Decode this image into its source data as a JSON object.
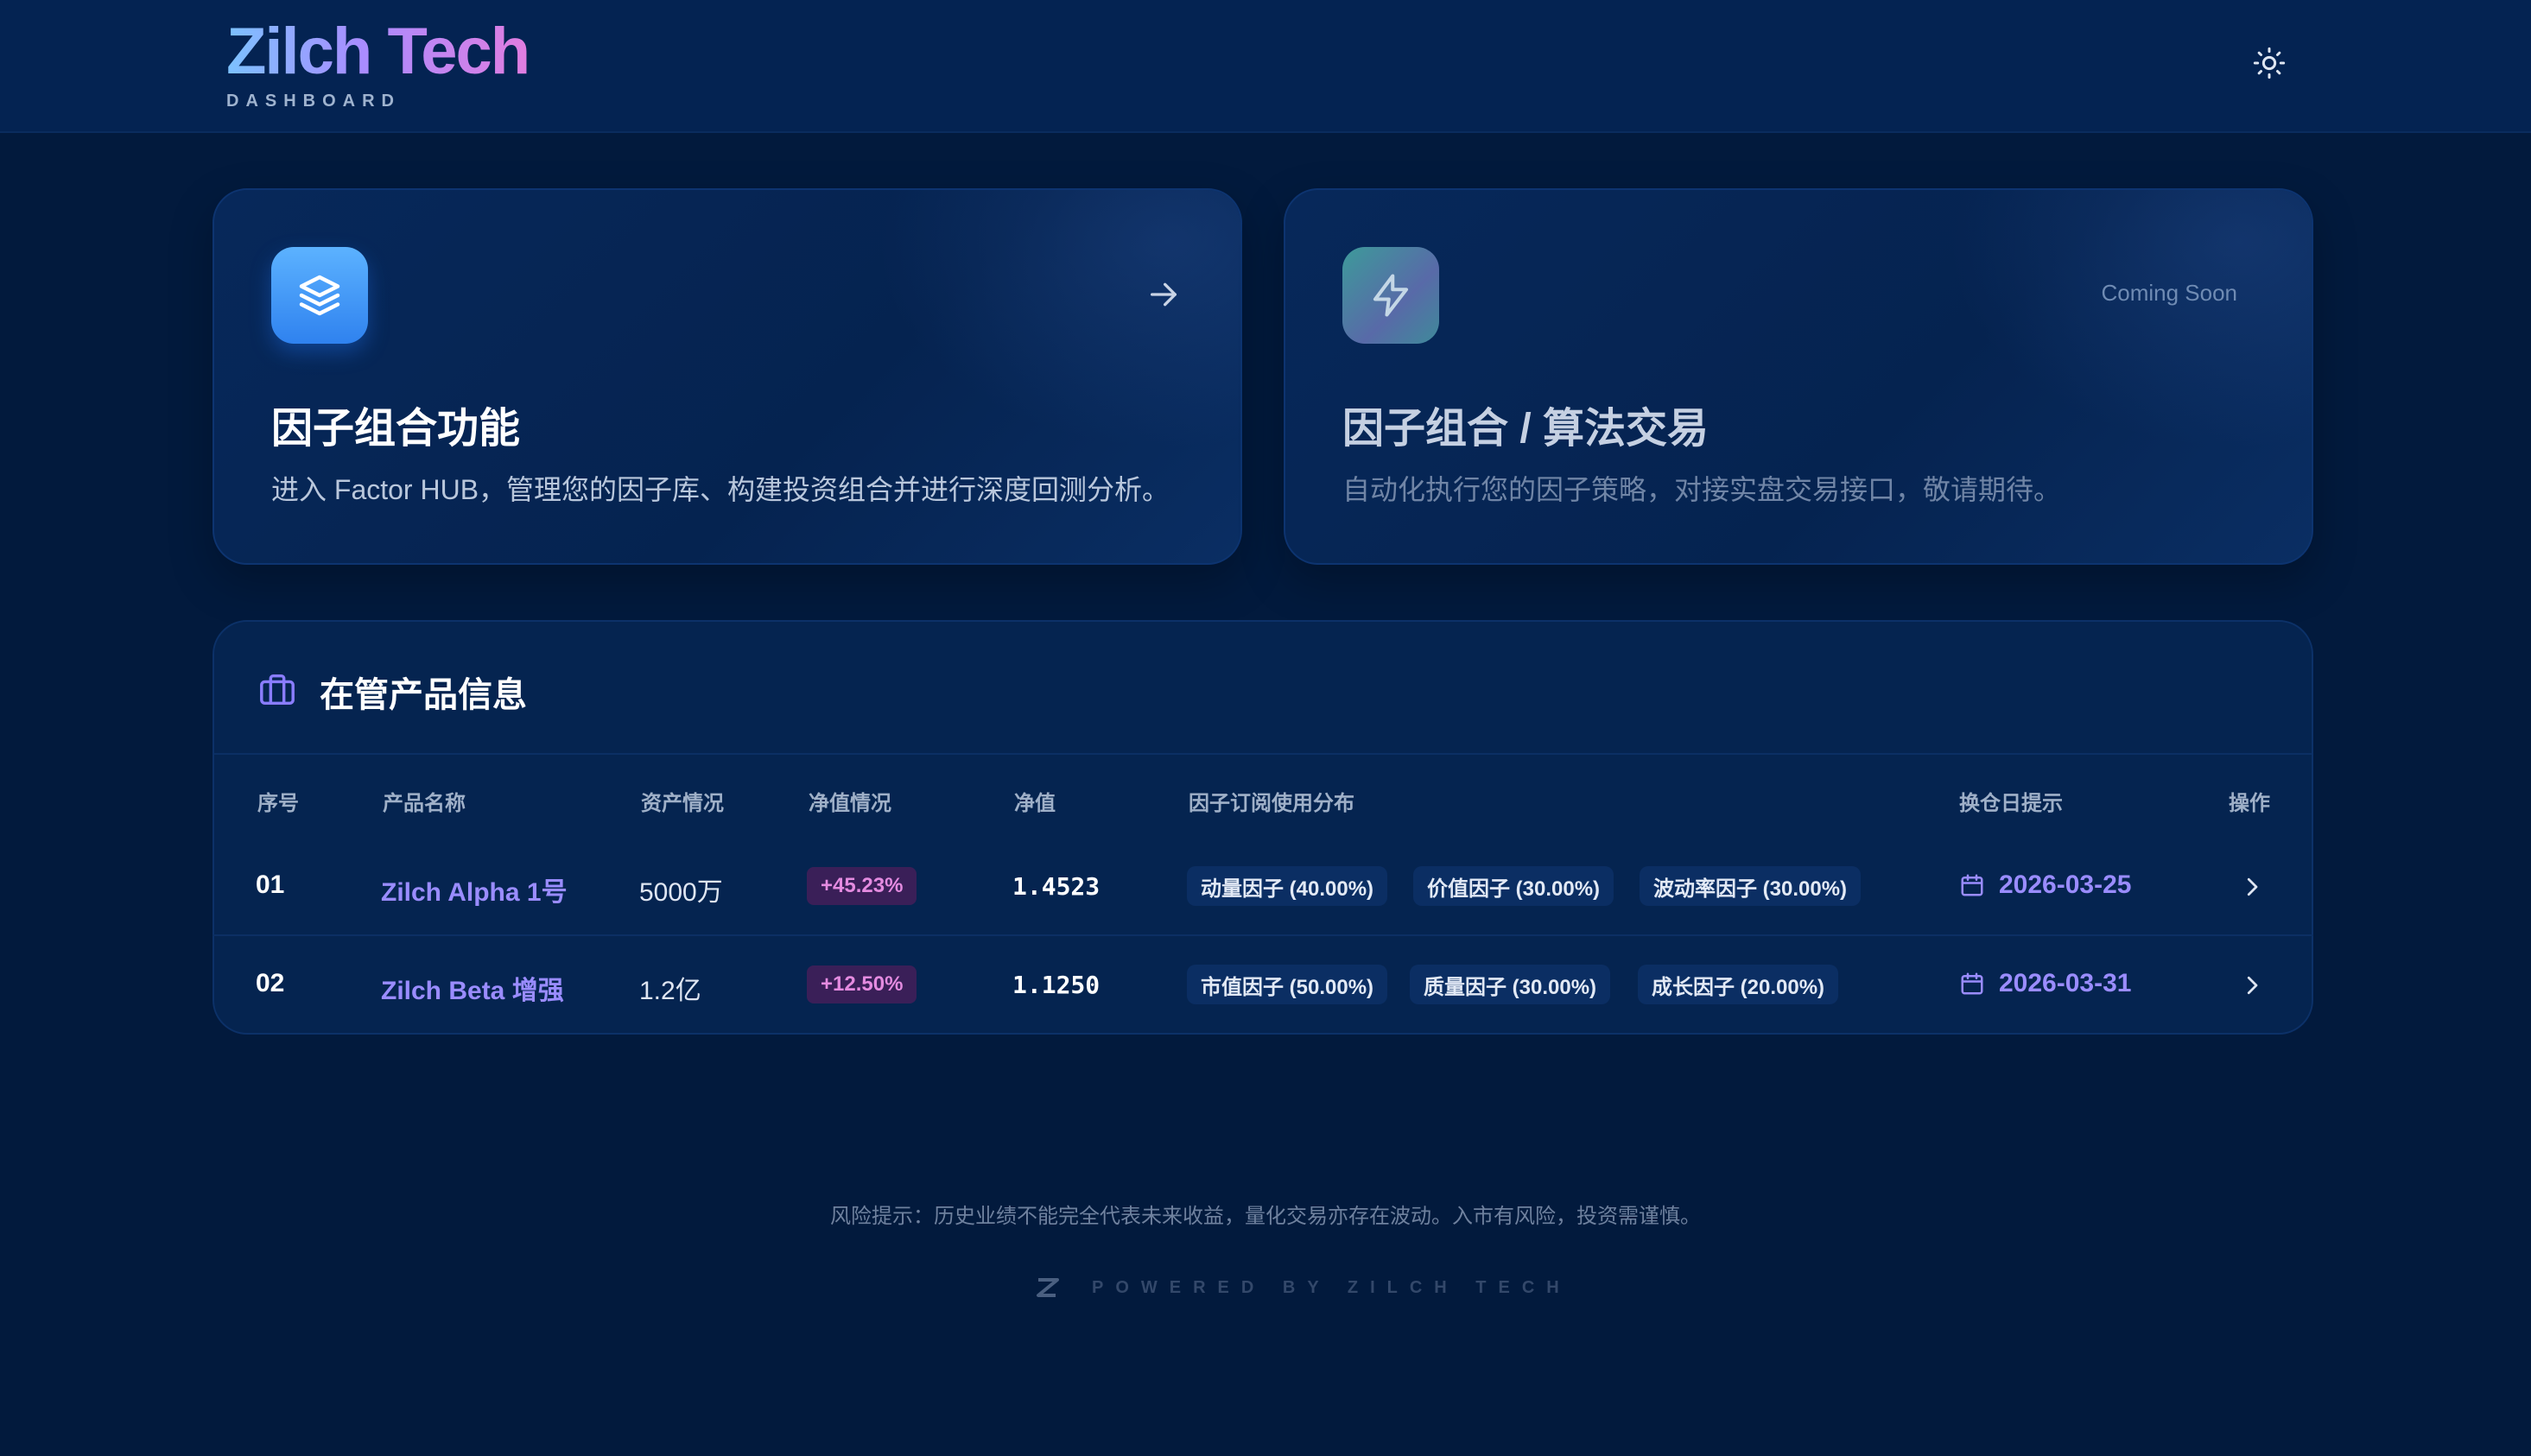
{
  "header": {
    "logo": "Zilch Tech",
    "subtitle": "DASHBOARD",
    "theme_icon": "sun-icon"
  },
  "cards": [
    {
      "icon": "layers-icon",
      "title": "因子组合功能",
      "description": "进入 Factor HUB，管理您的因子库、构建投资组合并进行深度回测分析。",
      "action_icon": "arrow-right-icon"
    },
    {
      "icon": "lightning-icon",
      "title": "因子组合 / 算法交易",
      "description": "自动化执行您的因子策略，对接实盘交易接口，敬请期待。",
      "badge": "Coming Soon"
    }
  ],
  "products": {
    "title": "在管产品信息",
    "icon": "briefcase-icon",
    "columns": [
      "序号",
      "产品名称",
      "资产情况",
      "净值情况",
      "净值",
      "因子订阅使用分布",
      "换仓日提示",
      "操作"
    ],
    "rows": [
      {
        "index": "01",
        "name": "Zilch Alpha 1号",
        "assets": "5000万",
        "return": "+45.23%",
        "nav": "1.4523",
        "factors": [
          "动量因子 (40.00%)",
          "价值因子 (30.00%)",
          "波动率因子 (30.00%)"
        ],
        "rebalance_date": "2026-03-25"
      },
      {
        "index": "02",
        "name": "Zilch Beta 增强",
        "assets": "1.2亿",
        "return": "+12.50%",
        "nav": "1.1250",
        "factors": [
          "市值因子 (50.00%)",
          "质量因子 (30.00%)",
          "成长因子 (20.00%)"
        ],
        "rebalance_date": "2026-03-31"
      }
    ]
  },
  "footer": {
    "risk_notice": "风险提示：历史业绩不能完全代表未来收益，量化交易亦存在波动。入市有风险，投资需谨慎。",
    "powered_by": "POWERED BY ZILCH TECH"
  },
  "colors": {
    "background": "#021a3d",
    "accent": "#9a8cff",
    "badge_text": "#e48be0"
  }
}
